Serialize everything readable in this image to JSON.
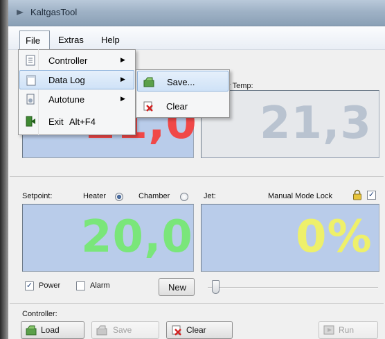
{
  "window": {
    "title": "KaltgasTool"
  },
  "menubar": {
    "file": "File",
    "extras": "Extras",
    "help": "Help"
  },
  "file_menu": {
    "items": [
      {
        "label": "Controller",
        "submenu": true
      },
      {
        "label": "Data Log",
        "submenu": true
      },
      {
        "label": "Autotune",
        "submenu": true
      },
      {
        "label": "Exit",
        "shortcut": "Alt+F4"
      }
    ]
  },
  "datalog_submenu": {
    "save": "Save...",
    "clear": "Clear"
  },
  "heater_display": {
    "value": "21,0",
    "color": "#f04848"
  },
  "chamber_display": {
    "label": "er Temp:",
    "value": "21,3",
    "color": "#b9c3d0"
  },
  "setpoint": {
    "label": "Setpoint:",
    "heater_label": "Heater",
    "chamber_label": "Chamber",
    "heater_selected": true,
    "value": "20,0",
    "color": "#7ae67a"
  },
  "jet": {
    "label": "Jet:",
    "manual_lock_label": "Manual Mode Lock",
    "manual_lock_checked": true,
    "value": "0%",
    "color": "#eef06a",
    "slider_value": 0
  },
  "options": {
    "power_label": "Power",
    "power_checked": true,
    "alarm_label": "Alarm",
    "alarm_checked": false
  },
  "new_button": "New",
  "controller": {
    "label": "Controller:",
    "load": "Load",
    "save": "Save",
    "clear": "Clear",
    "run": "Run"
  },
  "colors": {
    "display_blue": "#b9ccea",
    "display_grey": "#e6e8eb",
    "menu_highlight": "#cfe2f7"
  }
}
